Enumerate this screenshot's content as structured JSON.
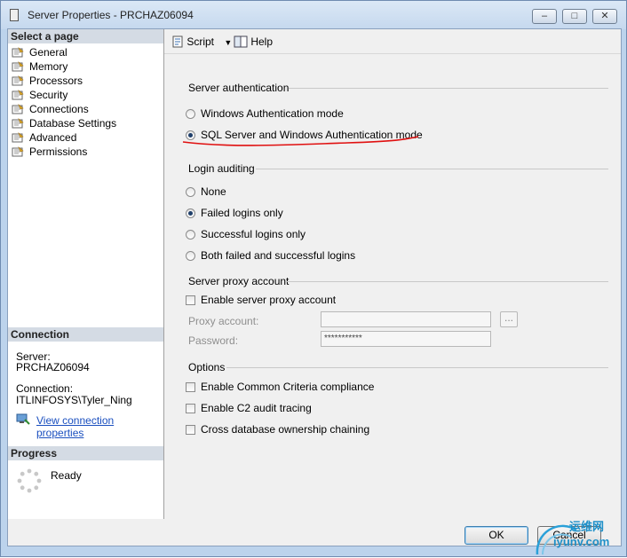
{
  "window": {
    "title": "Server Properties - PRCHAZ06094"
  },
  "left_panel": {
    "select_page_header": "Select a page",
    "pages": [
      {
        "label": "General"
      },
      {
        "label": "Memory"
      },
      {
        "label": "Processors"
      },
      {
        "label": "Security"
      },
      {
        "label": "Connections"
      },
      {
        "label": "Database Settings"
      },
      {
        "label": "Advanced"
      },
      {
        "label": "Permissions"
      }
    ],
    "connection_header": "Connection",
    "server_label": "Server:",
    "server_value": "PRCHAZ06094",
    "connection_label": "Connection:",
    "connection_value": "ITLINFOSYS\\Tyler_Ning",
    "view_link": "View connection properties",
    "progress_header": "Progress",
    "progress_status": "Ready"
  },
  "toolbar": {
    "script_label": "Script",
    "help_label": "Help"
  },
  "server_auth": {
    "title": "Server authentication",
    "options": [
      "Windows Authentication mode",
      "SQL Server and Windows Authentication mode"
    ],
    "selected": 1
  },
  "login_auditing": {
    "title": "Login auditing",
    "options": [
      "None",
      "Failed logins only",
      "Successful logins only",
      "Both failed and successful logins"
    ],
    "selected": 1
  },
  "proxy": {
    "title": "Server proxy account",
    "enable_label": "Enable server proxy account",
    "proxy_account_label": "Proxy account:",
    "proxy_account_value": "",
    "browse_label": "...",
    "password_label": "Password:",
    "password_value": "***********"
  },
  "options": {
    "title": "Options",
    "items": [
      "Enable Common Criteria compliance",
      "Enable C2 audit tracing",
      "Cross database ownership chaining"
    ]
  },
  "buttons": {
    "ok": "OK",
    "cancel": "Cancel"
  },
  "watermark": {
    "text_cn": "运维网",
    "text_en": "iyunv.com"
  },
  "colors": {
    "title_bar": "#c5d8ee",
    "link": "#1a4fbf",
    "annotation": "#e01010"
  }
}
